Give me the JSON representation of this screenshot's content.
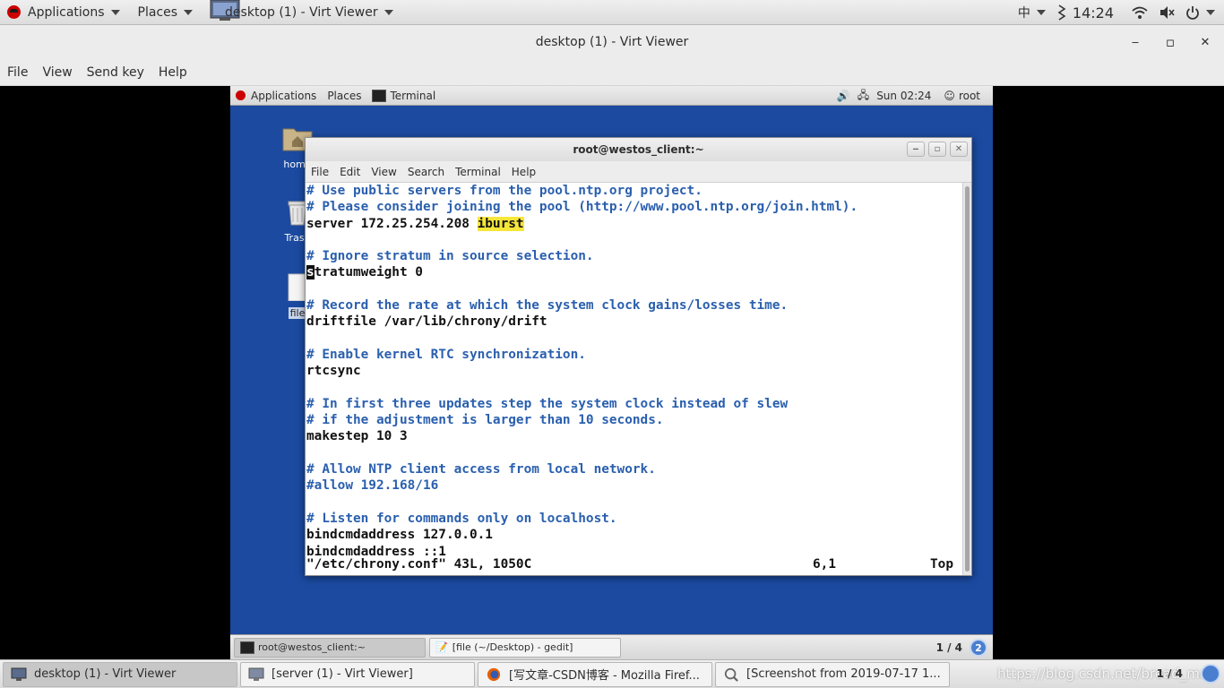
{
  "host_panel": {
    "applications": "Applications",
    "places": "Places",
    "window_menu": "desktop (1) - Virt Viewer",
    "input_method": "中",
    "time": "14:24"
  },
  "window": {
    "title": "desktop (1) - Virt Viewer",
    "minimize": "‒",
    "maximize": "▫",
    "close": "✕",
    "menu": [
      "File",
      "View",
      "Send key",
      "Help"
    ]
  },
  "guest": {
    "panel": {
      "applications": "Applications",
      "places": "Places",
      "terminal": "Terminal",
      "clock": "Sun 02:24",
      "user": "root"
    },
    "desktop_icons": [
      "home",
      "Trash",
      "file"
    ],
    "terminal": {
      "title": "root@westos_client:~",
      "menu": [
        "File",
        "Edit",
        "View",
        "Search",
        "Terminal",
        "Help"
      ],
      "lines": [
        {
          "c": "# Use public servers from the pool.ntp.org project.",
          "comment": true
        },
        {
          "c": "# Please consider joining the pool (http://www.pool.ntp.org/join.html).",
          "comment": true
        },
        {
          "c": "server 172.25.254.208 ",
          "hl": "iburst"
        },
        {
          "c": ""
        },
        {
          "c": "# Ignore stratum in source selection.",
          "comment": true
        },
        {
          "c": "tratumweight 0",
          "cursor": "s"
        },
        {
          "c": ""
        },
        {
          "c": "# Record the rate at which the system clock gains/losses time.",
          "comment": true
        },
        {
          "c": "driftfile /var/lib/chrony/drift"
        },
        {
          "c": ""
        },
        {
          "c": "# Enable kernel RTC synchronization.",
          "comment": true
        },
        {
          "c": "rtcsync"
        },
        {
          "c": ""
        },
        {
          "c": "# In first three updates step the system clock instead of slew",
          "comment": true
        },
        {
          "c": "# if the adjustment is larger than 10 seconds.",
          "comment": true
        },
        {
          "c": "makestep 10 3"
        },
        {
          "c": ""
        },
        {
          "c": "# Allow NTP client access from local network.",
          "comment": true
        },
        {
          "c": "#allow 192.168/16",
          "comment": true
        },
        {
          "c": ""
        },
        {
          "c": "# Listen for commands only on localhost.",
          "comment": true
        },
        {
          "c": "bindcmdaddress 127.0.0.1"
        },
        {
          "c": "bindcmdaddress ::1"
        }
      ],
      "status_file": "\"/etc/chrony.conf\" 43L, 1050C",
      "status_pos": "6,1",
      "status_top": "Top"
    },
    "taskbar": {
      "items": [
        "root@westos_client:~",
        "[file (~/Desktop) - gedit]"
      ],
      "workspace": "1 / 4"
    }
  },
  "host_taskbar": {
    "items": [
      "desktop (1) - Virt Viewer",
      "[server (1) - Virt Viewer]",
      "[写文章-CSDN博客 - Mozilla Firef...",
      "[Screenshot from 2019-07-17 1..."
    ],
    "watermark": "https://blog.csdn.net/bread_man",
    "workspace": "1 / 4"
  }
}
